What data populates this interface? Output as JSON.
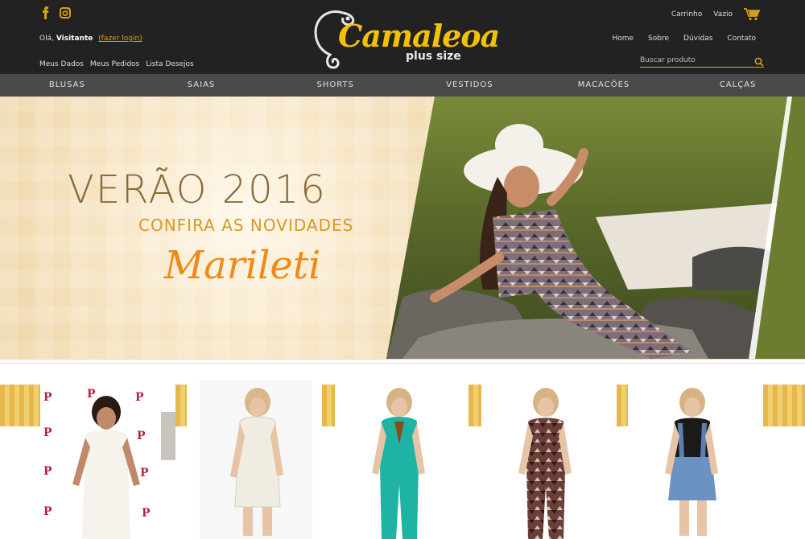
{
  "header": {
    "social": [
      "facebook-icon",
      "instagram-icon"
    ],
    "greeting_prefix": "Olá,",
    "greeting_name": "Visitante",
    "login_link": "(fazer login)",
    "account_links": [
      "Meus Dados",
      "Meus Pedidos",
      "Lista Desejos"
    ],
    "logo_text": "Camaleoa",
    "logo_sub": "plus size",
    "cart_label": "Carrinho",
    "cart_status": "Vazio",
    "main_links": [
      "Home",
      "Sobre",
      "Dúvidas",
      "Contato"
    ],
    "search_placeholder": "Buscar produto"
  },
  "categories": [
    "BLUSAS",
    "SAIAS",
    "SHORTS",
    "VESTIDOS",
    "MACACÕES",
    "CALÇAS"
  ],
  "hero": {
    "title": "VERÃO 2016",
    "subtitle": "CONFIRA AS NOVIDADES",
    "brand": "Marileti"
  },
  "colors": {
    "accent": "#d4a017",
    "header_bg": "#222222",
    "nav_bg": "#4a4a4a"
  }
}
